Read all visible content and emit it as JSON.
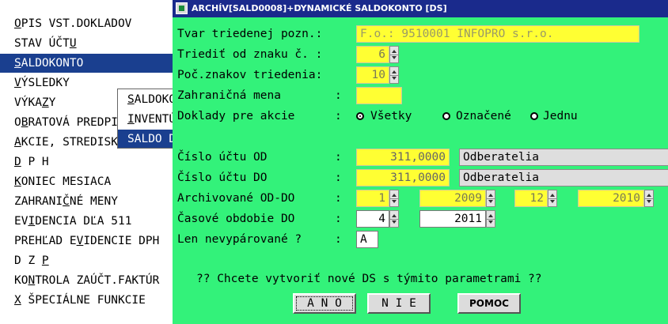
{
  "menu": {
    "items": [
      {
        "pre": "",
        "u": "O",
        "post": "PIS VST.DOKLADOV"
      },
      {
        "pre": "STAV ÚČT",
        "u": "U",
        "post": ""
      },
      {
        "pre": "",
        "u": "S",
        "post": "ALDOKONTO"
      },
      {
        "pre": "",
        "u": "V",
        "post": "ÝSLEDKY"
      },
      {
        "pre": "VÝKA",
        "u": "Z",
        "post": "Y"
      },
      {
        "pre": "O",
        "u": "B",
        "post": "RATOVÁ PREDPISY"
      },
      {
        "pre": "",
        "u": "A",
        "post": "KCIE, STREDISKÁ"
      },
      {
        "pre": "",
        "u": "D",
        "post": " P H"
      },
      {
        "pre": "",
        "u": "K",
        "post": "ONIEC MESIACA"
      },
      {
        "pre": "ZAHRANI",
        "u": "Č",
        "post": "NÉ MENY"
      },
      {
        "pre": "EV",
        "u": "I",
        "post": "DENCIA DĽA 511"
      },
      {
        "pre": "PREHĽAD E",
        "u": "V",
        "post": "IDENCIE DPH"
      },
      {
        "pre": "D Z ",
        "u": "P",
        "post": ""
      },
      {
        "pre": "KO",
        "u": "N",
        "post": "TROLA ZAÚČT.FAKTÚR"
      },
      {
        "pre": "",
        "u": "X",
        "post": " ŠPECIÁLNE FUNKCIE"
      }
    ]
  },
  "submenu": {
    "items": [
      {
        "pre": "",
        "u": "S",
        "post": "ALDOKONTO"
      },
      {
        "pre": "",
        "u": "I",
        "post": "NVENTÚRA"
      },
      {
        "pre": "SALDO",
        "u": "",
        "post": " DS"
      }
    ]
  },
  "window": {
    "title": "ARCHÍV[SALD0008]+DYNAMICKÉ SALDOKONTO [DS]"
  },
  "form": {
    "labels": {
      "tvar": "Tvar triedenej pozn.:",
      "triedit": "Triediť od znaku č. :",
      "poc": "Poč.znakov triedenia:",
      "mena": "Zahraničná mena",
      "doklady": "Doklady pre akcie",
      "od": "Číslo účtu OD",
      "do": "Číslo účtu DO",
      "arch": "Archivované OD-DO",
      "cas": "Časové obdobie DO",
      "len": "Len nevypárované ?"
    },
    "colon": ":",
    "tvar_value": "F.o.:   9510001 INFOPRO s.r.o.",
    "triedit_value": "6",
    "poc_value": "10",
    "mena_value": "",
    "radio_vsetky": "Všetky",
    "radio_oznacene": "Označené",
    "radio_jednu": "Jednu",
    "od_value": "311,0000",
    "od_name": "Odberatelia",
    "do_value": "311,0000",
    "do_name": "Odberatelia",
    "arch_m1": "1",
    "arch_y1": "2009",
    "arch_m2": "12",
    "arch_y2": "2010",
    "cas_m": "4",
    "cas_y": "2011",
    "len_value": "A",
    "question": "?? Chcete vytvoriť nové DS s týmito parametrami ??",
    "btn_ano": "A N O",
    "btn_nie": "N I E",
    "btn_pomoc": "POMOC"
  }
}
